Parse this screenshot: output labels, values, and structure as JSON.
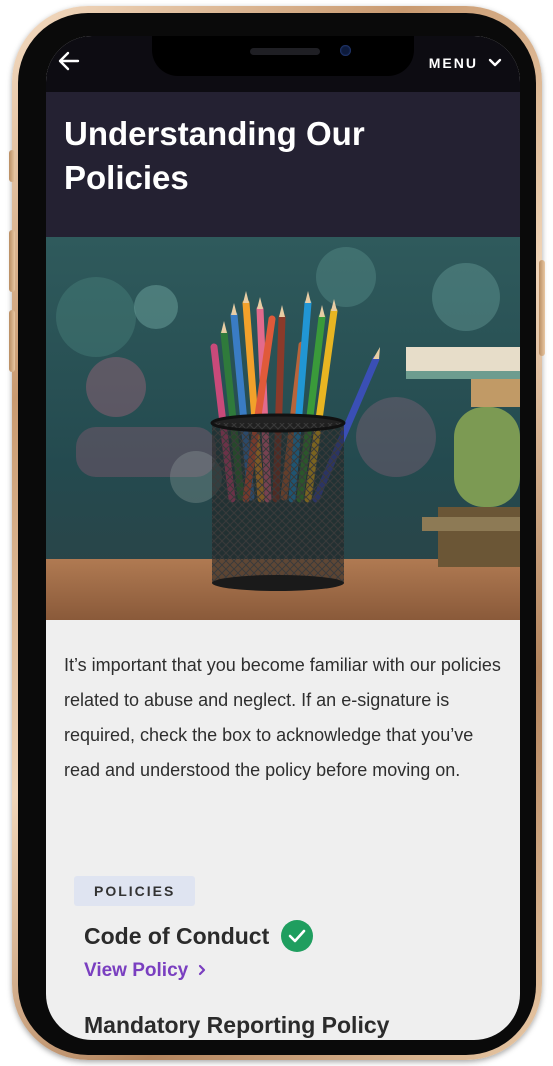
{
  "topbar": {
    "back_icon": "arrow-left-icon",
    "menu_label": "MENU",
    "menu_icon": "chevron-down-icon"
  },
  "header": {
    "title": "Understanding Our Policies",
    "background": "#242132"
  },
  "hero_image": {
    "subject": "pencil-holder-with-colored-pencils-and-books"
  },
  "intro": {
    "text": "It’s important that you become familiar with our policies related to abuse and neglect. If an e-signature is required, check the box to acknowledge that you’ve read and understood the policy before moving on."
  },
  "policies": {
    "badge_label": "POLICIES",
    "items": [
      {
        "title": "Code of Conduct",
        "completed": true,
        "link_label": "View Policy"
      },
      {
        "title": "Mandatory Reporting Policy"
      }
    ]
  },
  "colors": {
    "accent_link": "#7a3fc0",
    "check_green": "#1f9e5f",
    "badge_bg": "#dfe4f1",
    "page_bg": "#efefef"
  }
}
